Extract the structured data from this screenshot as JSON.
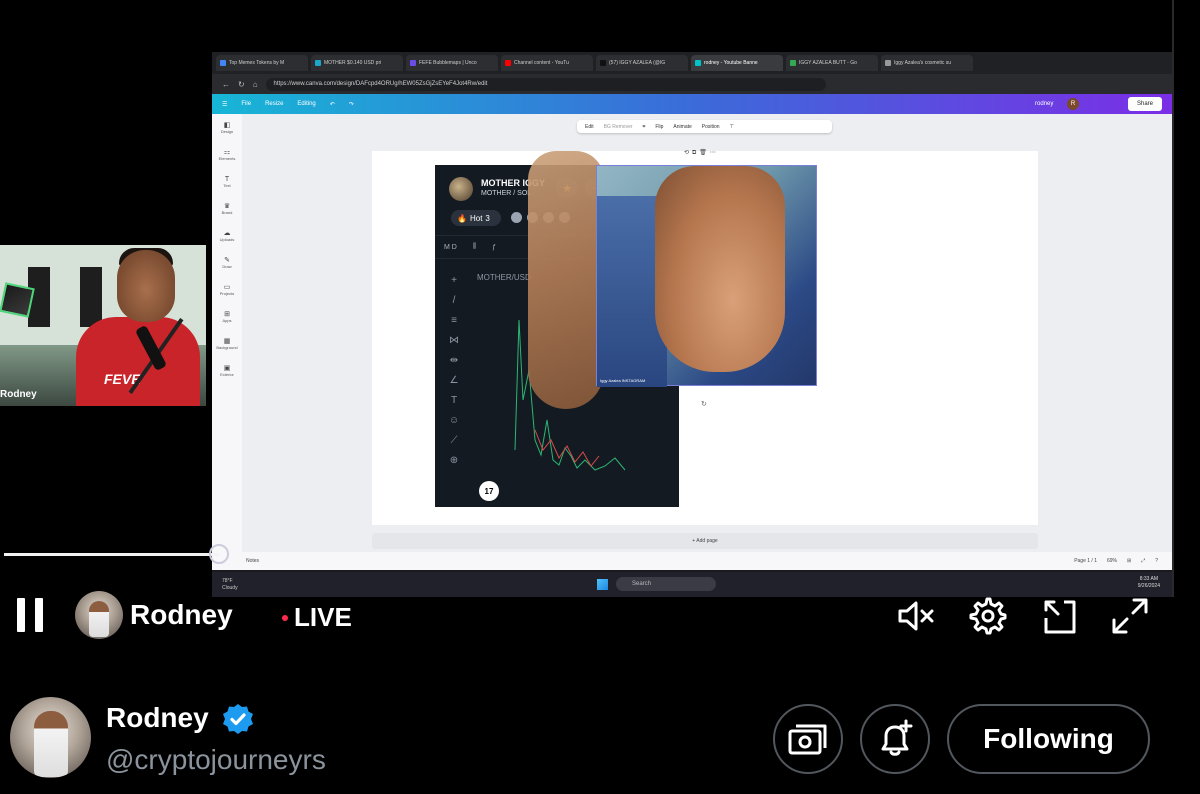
{
  "browser": {
    "tabs": [
      {
        "label": "Top Memes Tokens by M",
        "color": "#4285f4"
      },
      {
        "label": "MOTHER $0.140 USD pri",
        "color": "#1aa7c9"
      },
      {
        "label": "FEFE Bubblemaps | Unco",
        "color": "#6b4de6"
      },
      {
        "label": "Channel content - YouTu",
        "color": "#ff0000"
      },
      {
        "label": "(57) IGGY AZALEA (@IG",
        "color": "#111111"
      },
      {
        "label": "rodney - Youtube Banne",
        "color": "#00c4cc"
      },
      {
        "label": "IGGY AZALEA BUTT - Go",
        "color": "#34a853"
      },
      {
        "label": "Iggy Azalea's cosmetic su",
        "color": "#999999"
      }
    ],
    "url": "https://www.canva.com/design/DAFcpd4ORUg/hEW05ZsGjZsEYeF4Jot4Rw/edit"
  },
  "canva": {
    "menu": [
      "File",
      "Resize",
      "Editing"
    ],
    "user": "rodney",
    "user_initial": "R",
    "share": "Share",
    "sidebar": [
      "Design",
      "Elements",
      "Text",
      "Brand",
      "Uploads",
      "Draw",
      "Projects",
      "Apps",
      "Background",
      "Exterior"
    ],
    "context_toolbar": [
      "Edit",
      "BG Remover",
      "Flip",
      "Animate",
      "Position"
    ],
    "add_page": "+ Add page",
    "notes": "Notes",
    "page_indicator": "Page 1 / 1",
    "zoom": "69%"
  },
  "chart_card": {
    "title": "MOTHER IGGY",
    "subtitle": "MOTHER / SOL",
    "hot": "Hot",
    "hot_count": "3",
    "pair": "MOTHER/USD",
    "timeframe": "M D",
    "tv": "17",
    "photo_caption": "Iggy Azalea INSTAGRAM"
  },
  "taskbar": {
    "weather_temp": "78°F",
    "weather_desc": "Cloudy",
    "search": "Search",
    "time": "8:33 AM",
    "date": "9/26/2024"
  },
  "webcam": {
    "name": "Rodney",
    "shirt": "FEVE"
  },
  "player": {
    "progress": 0.18,
    "streamer": "Rodney",
    "live": "LIVE"
  },
  "profile": {
    "name": "Rodney",
    "handle": "@cryptojourneyrs",
    "verified": true,
    "follow_label": "Following"
  },
  "colors": {
    "live_dot": "#ff2b4a",
    "verified": "#1d9bf0",
    "button_border": "#52575d"
  }
}
